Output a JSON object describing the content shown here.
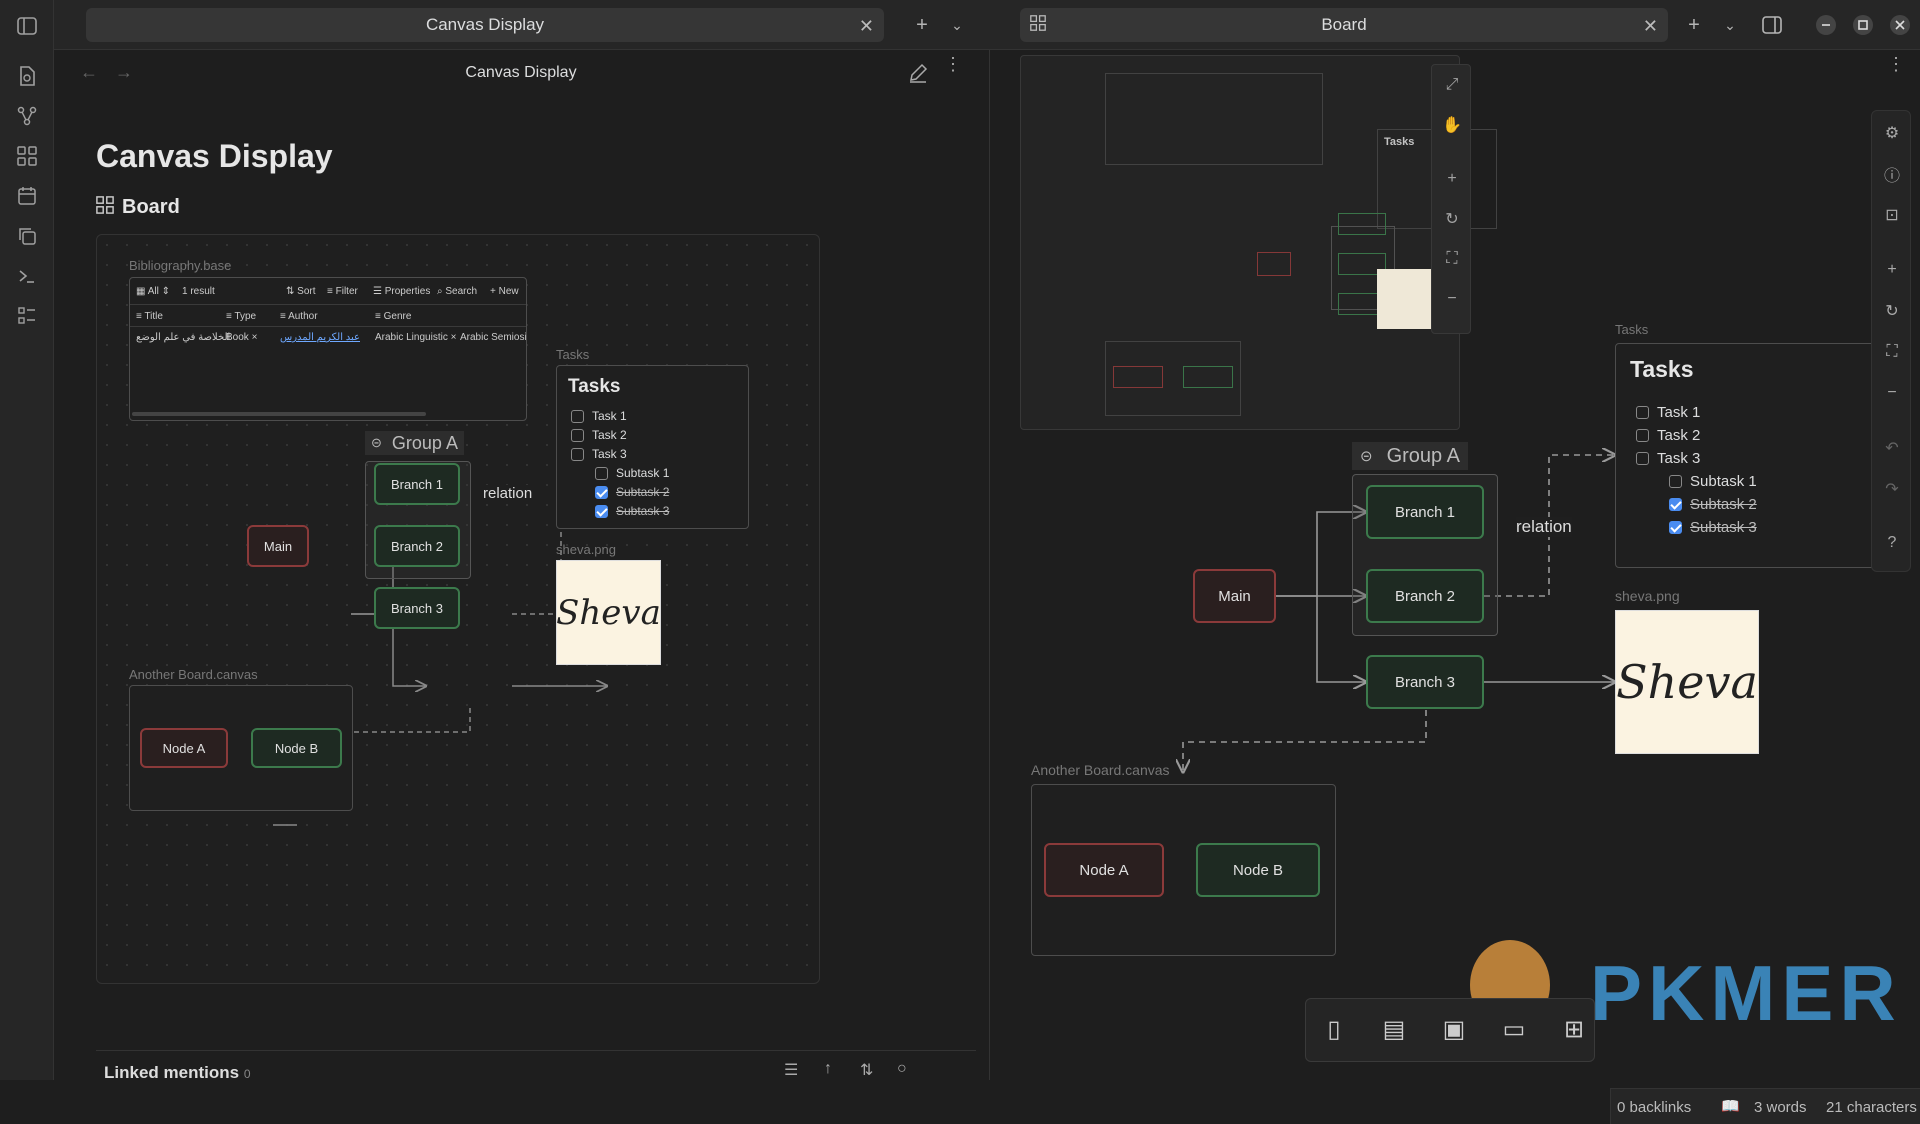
{
  "tabs": {
    "left": {
      "title": "Canvas Display"
    },
    "right": {
      "title": "Board"
    }
  },
  "left": {
    "nav_title": "Canvas Display",
    "page_title": "Canvas Display",
    "board_heading": "Board",
    "base": {
      "label": "Bibliography.base",
      "view": "All",
      "results": "1 result",
      "toolbar": [
        "Sort",
        "Filter",
        "Properties",
        "Search",
        "New"
      ],
      "columns": [
        "Title",
        "Type",
        "Author",
        "Genre"
      ],
      "row": {
        "title": "الخلاصة في علم الوضع",
        "type": "Book",
        "author": "عبد الكريم المدرس",
        "genre1": "Arabic Linguistic",
        "genre2": "Arabic Semiosis"
      }
    },
    "tasks": {
      "label": "Tasks",
      "title": "Tasks",
      "items": [
        "Task 1",
        "Task 2",
        "Task 3"
      ],
      "subitems": [
        "Subtask 1",
        "Subtask 2",
        "Subtask 3"
      ]
    },
    "group": "Group A",
    "nodes": {
      "main": "Main",
      "b1": "Branch 1",
      "b2": "Branch 2",
      "b3": "Branch 3"
    },
    "relation": "relation",
    "image_label": "sheva.png",
    "signature": "Sheva",
    "another": {
      "label": "Another Board.canvas",
      "a": "Node A",
      "b": "Node B"
    },
    "linked": {
      "title": "Linked mentions",
      "count": "0"
    }
  },
  "right": {
    "group": "Group A",
    "nodes": {
      "main": "Main",
      "b1": "Branch 1",
      "b2": "Branch 2",
      "b3": "Branch 3"
    },
    "relation": "relation",
    "tasks_label": "Tasks",
    "tasks_title": "Tasks",
    "items": [
      "Task 1",
      "Task 2",
      "Task 3"
    ],
    "subitems": [
      "Subtask 1",
      "Subtask 2",
      "Subtask 3"
    ],
    "image_label": "sheva.png",
    "signature": "Sheva",
    "another": {
      "label": "Another Board.canvas",
      "a": "Node A",
      "b": "Node B"
    },
    "watermark": "PKMER",
    "status": {
      "backlinks": "0 backlinks",
      "words": "3 words",
      "chars": "21 characters"
    }
  }
}
